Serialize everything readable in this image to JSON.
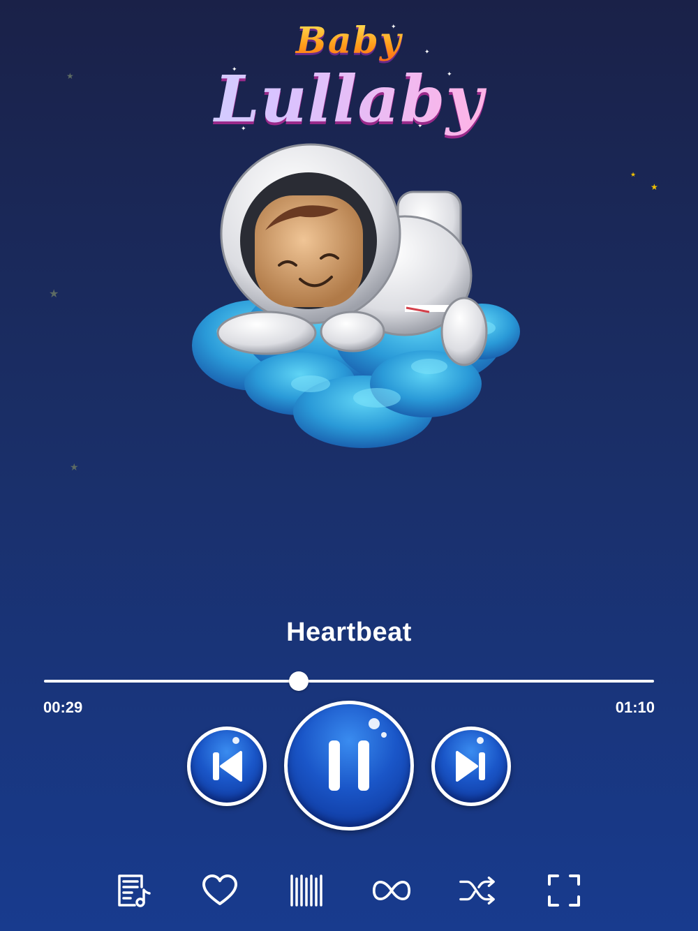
{
  "app": {
    "logo_line1": "Baby",
    "logo_line2": "Lullaby"
  },
  "player": {
    "track_title": "Heartbeat",
    "time_current": "00:29",
    "time_total": "01:10",
    "progress_fraction": 0.418
  },
  "controls": {
    "previous_icon": "skip-previous-icon",
    "play_pause_icon": "pause-icon",
    "next_icon": "skip-next-icon"
  },
  "toolbar": {
    "icons": [
      "playlist-icon",
      "heart-icon",
      "barcode-timer-icon",
      "infinity-loop-icon",
      "shuffle-icon",
      "fullscreen-icon"
    ]
  },
  "colors": {
    "accent": "#1a56c8",
    "background_top": "#1a2148",
    "background_bottom": "#183b8e",
    "star": "#f2c200"
  }
}
